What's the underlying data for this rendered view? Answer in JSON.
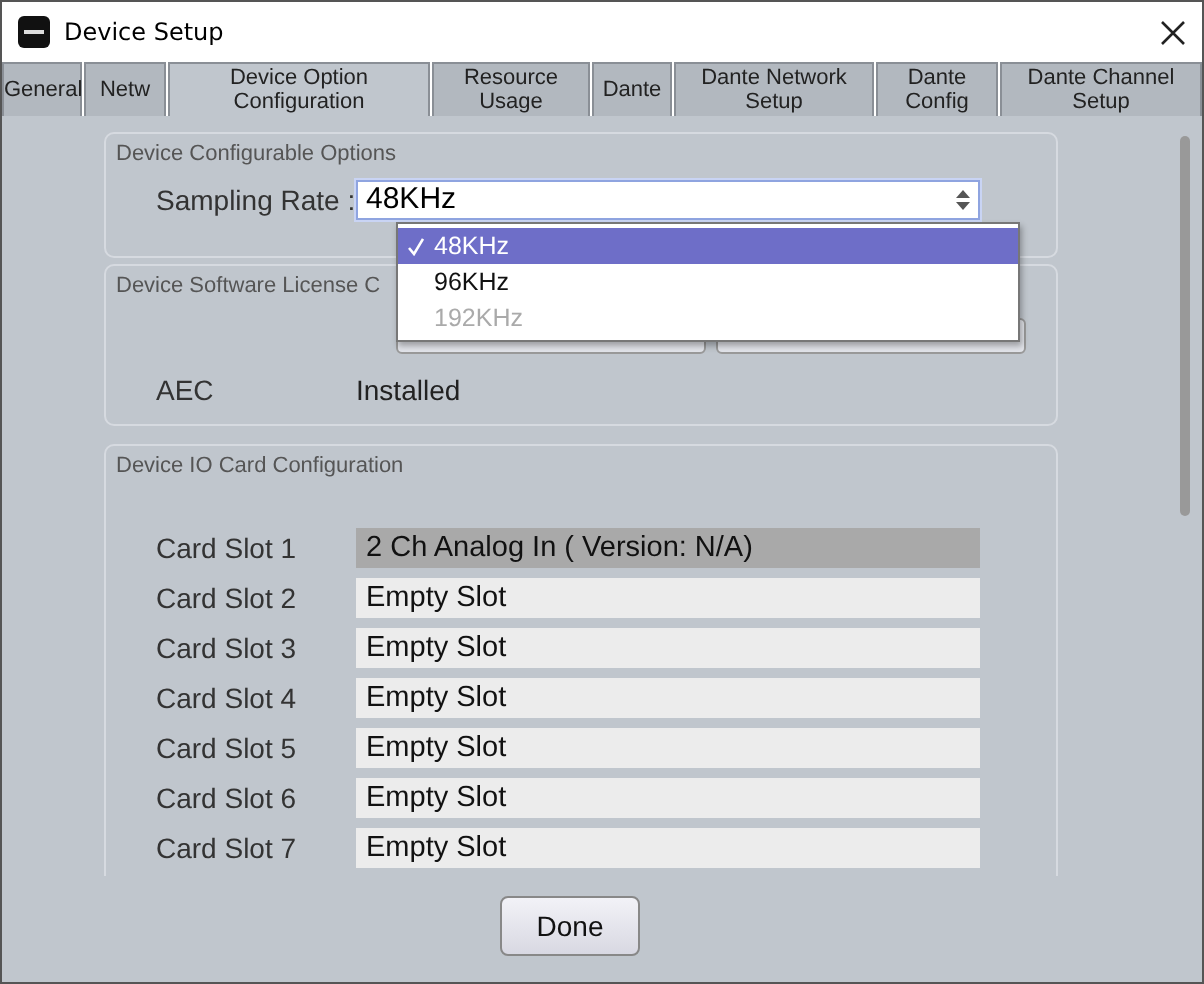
{
  "window": {
    "title": "Device Setup"
  },
  "tabs": [
    {
      "label": "General",
      "selected": false
    },
    {
      "label": "Netw",
      "selected": false
    },
    {
      "label": "Device Option Configuration",
      "selected": true
    },
    {
      "label": "Resource Usage",
      "selected": false
    },
    {
      "label": "Dante",
      "selected": false
    },
    {
      "label": "Dante Network Setup",
      "selected": false
    },
    {
      "label": "Dante Config",
      "selected": false
    },
    {
      "label": "Dante Channel Setup",
      "selected": false
    }
  ],
  "configurable_options": {
    "title": "Device Configurable Options",
    "sampling_rate": {
      "label": "Sampling Rate :",
      "value": "48KHz",
      "expanded": true,
      "options": [
        {
          "label": "48KHz",
          "selected": true,
          "disabled": false
        },
        {
          "label": "96KHz",
          "selected": false,
          "disabled": false
        },
        {
          "label": "192KHz",
          "selected": false,
          "disabled": true
        }
      ]
    }
  },
  "license": {
    "title": "Device Software License C",
    "features": [
      {
        "name": "AEC",
        "status": "Installed"
      }
    ]
  },
  "io_cards": {
    "title": "Device IO Card Configuration",
    "slots": [
      {
        "label": "Card Slot 1",
        "value": "2 Ch Analog In ( Version: N/A)",
        "populated": true
      },
      {
        "label": "Card Slot 2",
        "value": "Empty Slot",
        "populated": false
      },
      {
        "label": "Card Slot 3",
        "value": "Empty Slot",
        "populated": false
      },
      {
        "label": "Card Slot 4",
        "value": "Empty Slot",
        "populated": false
      },
      {
        "label": "Card Slot 5",
        "value": "Empty Slot",
        "populated": false
      },
      {
        "label": "Card Slot 6",
        "value": "Empty Slot",
        "populated": false
      },
      {
        "label": "Card Slot 7",
        "value": "Empty Slot",
        "populated": false
      }
    ]
  },
  "buttons": [
    "Done"
  ]
}
